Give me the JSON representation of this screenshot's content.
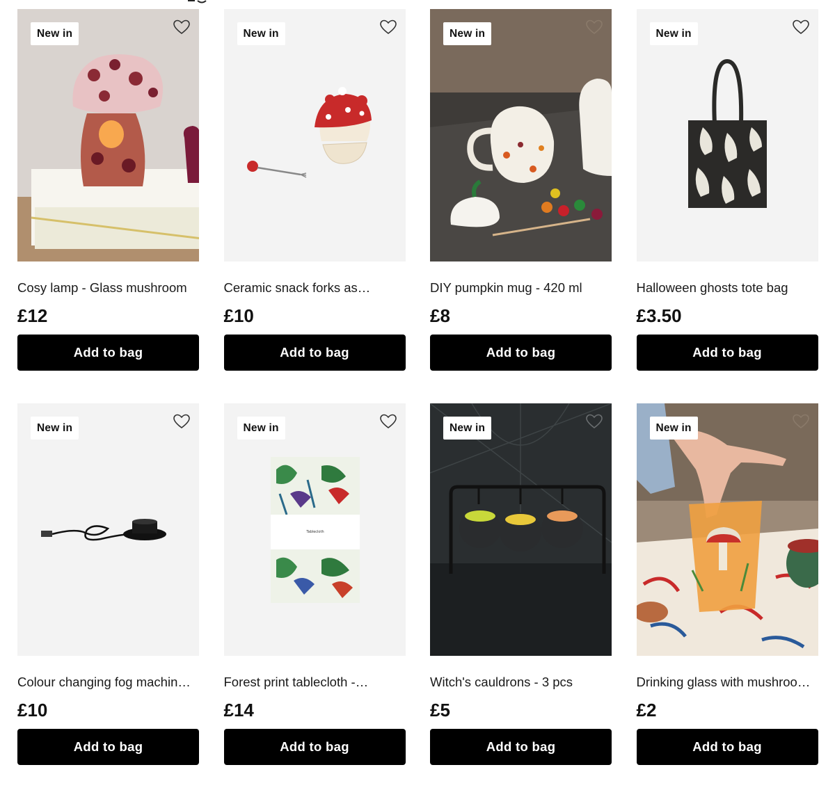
{
  "products": [
    {
      "badge": "New in",
      "name": "Cosy lamp - Glass mushroom",
      "price": "£12",
      "button": "Add to bag",
      "image": "glass-mushroom-lamp-photo"
    },
    {
      "badge": "New in",
      "name": "Ceramic snack forks as…",
      "price": "£10",
      "button": "Add to bag",
      "image": "mushroom-snack-forks-photo"
    },
    {
      "badge": "New in",
      "name": "DIY pumpkin mug - 420 ml",
      "price": "£8",
      "button": "Add to bag",
      "image": "pumpkin-mug-photo"
    },
    {
      "badge": "New in",
      "name": "Halloween ghosts tote bag",
      "price": "£3.50",
      "button": "Add to bag",
      "image": "ghost-tote-bag-photo"
    },
    {
      "badge": "New in",
      "name": "Colour changing fog machin…",
      "price": "£10",
      "button": "Add to bag",
      "image": "fog-machine-photo"
    },
    {
      "badge": "New in",
      "name": "Forest print tablecloth -…",
      "price": "£14",
      "button": "Add to bag",
      "image": "forest-tablecloth-photo"
    },
    {
      "badge": "New in",
      "name": "Witch's cauldrons - 3 pcs",
      "price": "£5",
      "button": "Add to bag",
      "image": "witch-cauldrons-photo"
    },
    {
      "badge": "New in",
      "name": "Drinking glass with mushroo…",
      "price": "£2",
      "button": "Add to bag",
      "image": "mushroom-glass-photo"
    }
  ],
  "icons": {
    "favourite": "heart-outline-icon"
  },
  "colors": {
    "button_bg": "#000000",
    "button_text": "#ffffff",
    "badge_bg": "#ffffff",
    "card_bg": "#f2f2f2"
  }
}
